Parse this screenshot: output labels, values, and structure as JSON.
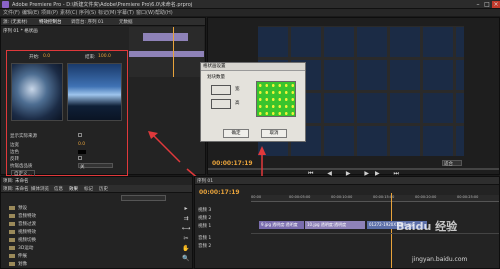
{
  "window": {
    "title": "Adobe Premiere Pro - D:\\新建文件夹\\Adobe\\Premiere Pro\\6.0\\未命名.prproj"
  },
  "menu": [
    "文件(F)",
    "编辑(E)",
    "项目(P)",
    "素材(C)",
    "序列(S)",
    "标记(M)",
    "字幕(T)",
    "窗口(W)",
    "帮助(H)"
  ],
  "effect_controls": {
    "tabs": [
      "源: (无素材)",
      "特效控制台",
      "调音台: 序列 01",
      "元数据"
    ],
    "sequence_label": "序列 01 * 格状画",
    "header_label": "视频",
    "clip_label": "序列 01 * 10.jpg",
    "start_label": "开始:",
    "start_value": "0.0",
    "end_label": "结束:",
    "end_value": "100.0",
    "show_actual_label": "显示实际来源",
    "params": [
      {
        "name": "边宽",
        "value": "0.0"
      },
      {
        "name": "边色",
        "value": ""
      },
      {
        "name": "反转",
        "value": ""
      },
      {
        "name": "抗锯齿品质",
        "value": "关"
      }
    ],
    "custom_label": "自定义..."
  },
  "monitor": {
    "timecode": "00:00:17:19",
    "fit": "适合",
    "quality": "1/2",
    "controls": [
      "⏮",
      "◀",
      "▶",
      "▶▶",
      "⏭"
    ]
  },
  "dialog": {
    "title": "格状画设置",
    "label": "划块数量",
    "wide_label": "宽",
    "high_label": "高",
    "wide_value": "8",
    "high_value": "8",
    "ok": "确定",
    "cancel": "取消"
  },
  "project": {
    "title": "项目: 未命名",
    "tabs": [
      "项目: 未命名",
      "媒体浏览",
      "信息",
      "效果",
      "标记",
      "历史"
    ],
    "search_placeholder": "",
    "items": [
      "预设",
      "音频特效",
      "音频过渡",
      "视频特效",
      "视频切换",
      "3D运动",
      "伸展",
      "划像",
      "卷页",
      "叠化"
    ]
  },
  "timeline": {
    "tab": "序列 01",
    "timecode": "00:00:17:19",
    "ruler": [
      "00:00",
      "00:00:05:00",
      "00:00:10:00",
      "00:00:15:00",
      "00:00:20:00",
      "00:00:25:00"
    ],
    "tracks": [
      {
        "name": "视频 3"
      },
      {
        "name": "视频 2"
      },
      {
        "name": "视频 1"
      },
      {
        "name": "音频 1"
      },
      {
        "name": "音频 2"
      }
    ],
    "clips": [
      {
        "label": "9.jpg  透明度:透明度",
        "track": "视频 1"
      },
      {
        "label": "10.jpg  透明度:透明度",
        "track": "视频 1"
      },
      {
        "label": "01272-1920X1080.mp",
        "track": "视频 1"
      }
    ]
  },
  "watermark": "Baidu 经验",
  "watermark_url": "jingyan.baidu.com",
  "colors": {
    "accent": "#8a63c9",
    "highlight": "#e0393b",
    "playhead": "#e8a33b"
  }
}
